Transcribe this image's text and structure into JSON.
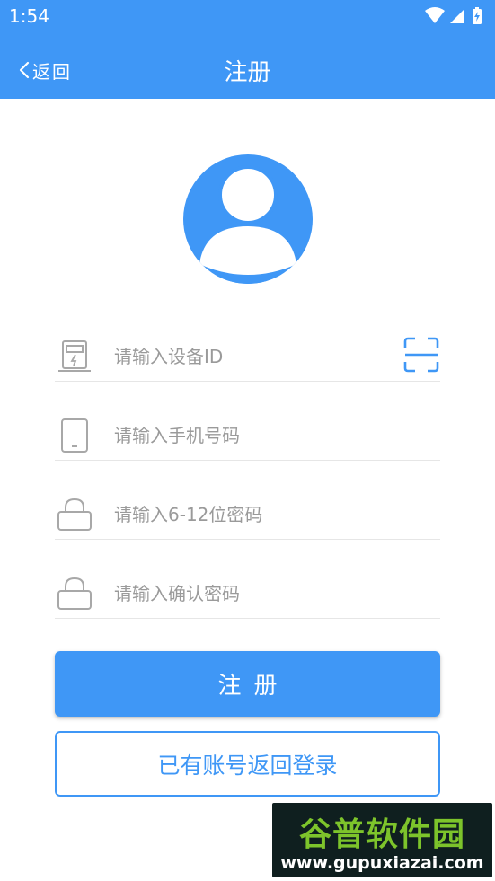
{
  "status_bar": {
    "time": "1:54"
  },
  "header": {
    "back_label": "返回",
    "title": "注册"
  },
  "form": {
    "device_id_placeholder": "请输入设备ID",
    "phone_placeholder": "请输入手机号码",
    "password_placeholder": "请输入6-12位密码",
    "confirm_password_placeholder": "请输入确认密码"
  },
  "buttons": {
    "register_label": "注册",
    "login_link_label": "已有账号返回登录"
  },
  "watermark": {
    "brand": "谷普软件园",
    "url": "www.gupuxiazai.com"
  },
  "colors": {
    "primary": "#3f97f6",
    "placeholder": "#9a9a9a",
    "icon_gray": "#a8a8a8"
  }
}
